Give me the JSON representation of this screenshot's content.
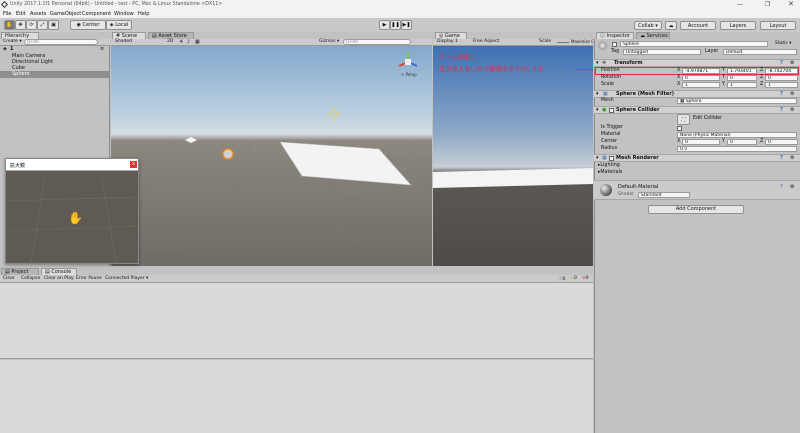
{
  "window": {
    "title": "Unity 2017.1.1f1 Personal (64bit) - Untitled - test - PC, Mac & Linux Standalone <DX11>"
  },
  "menu": [
    "File",
    "Edit",
    "Assets",
    "GameObject",
    "Component",
    "Window",
    "Help"
  ],
  "toolbar": {
    "center_label": "Center",
    "local_label": "Local",
    "collab_label": "Collab ▾",
    "account_label": "Account",
    "layers_label": "Layers",
    "layout_label": "Layout"
  },
  "hierarchy": {
    "tab": "Hierarchy",
    "create_label": "Create ▾",
    "search_placeholder": "Q•All",
    "scene_name": "1",
    "items": [
      "Main Camera",
      "Directional Light",
      "Cube",
      "Sphere"
    ]
  },
  "scene": {
    "tab": "Scene",
    "asset_store_tab": "Asset Store",
    "shading": "Shaded",
    "mode_2d": "2D",
    "gizmos": "Gizmos ▾",
    "search_placeholder": "Q•All",
    "persp_label": "< Persp"
  },
  "game": {
    "tab": "Game",
    "display": "Display 1",
    "aspect": "Free Aspect",
    "scale_label": "Scale",
    "maximize_label": "Maximize On Play",
    "annotation_line1": "ゲーム画面に",
    "annotation_line2": "玉が見えないので座標を全て0にする"
  },
  "magnifier": {
    "title": "拡大鏡",
    "close": "x"
  },
  "bottom": {
    "project_tab": "Project",
    "console_tab": "Console",
    "buttons": [
      "Clear",
      "Collapse",
      "Clear on Play",
      "Error Pause",
      "Connected Player ▾"
    ],
    "counts": [
      "0",
      "0",
      "0"
    ]
  },
  "inspector": {
    "tab": "Inspector",
    "services_tab": "Services",
    "object_name": "Sphere",
    "static_label": "Static ▾",
    "tag_label": "Tag",
    "tag_value": "Untagged",
    "layer_label": "Layer",
    "layer_value": "Default",
    "transform": {
      "title": "Transform",
      "position_label": "Position",
      "position": {
        "x": "-4.974871",
        "y": "1.793401",
        "z": "-8.742704"
      },
      "rotation_label": "Rotation",
      "rotation": {
        "x": "0",
        "y": "0",
        "z": "0"
      },
      "scale_label": "Scale",
      "scale": {
        "x": "1",
        "y": "1",
        "z": "1"
      }
    },
    "mesh_filter": {
      "title": "Sphere (Mesh Filter)",
      "mesh_label": "Mesh",
      "mesh_value": "Sphere"
    },
    "collider": {
      "title": "Sphere Collider",
      "edit_label": "Edit Collider",
      "trigger_label": "Is Trigger",
      "material_label": "Material",
      "material_value": "None (Physic Material)",
      "center_label": "Center",
      "center": {
        "x": "0",
        "y": "0",
        "z": "0"
      },
      "radius_label": "Radius",
      "radius_value": "0.5"
    },
    "renderer": {
      "title": "Mesh Renderer",
      "lighting": "Lighting",
      "materials": "Materials"
    },
    "material": {
      "name": "Default-Material",
      "shader_label": "Shader",
      "shader_value": "Standard"
    },
    "add_component": "Add Component",
    "axis": {
      "x": "X",
      "y": "Y",
      "z": "Z"
    }
  },
  "colors": {
    "annotation": "#e0303a",
    "selection": "#3d6fb8",
    "accent": "#3c96e8"
  }
}
